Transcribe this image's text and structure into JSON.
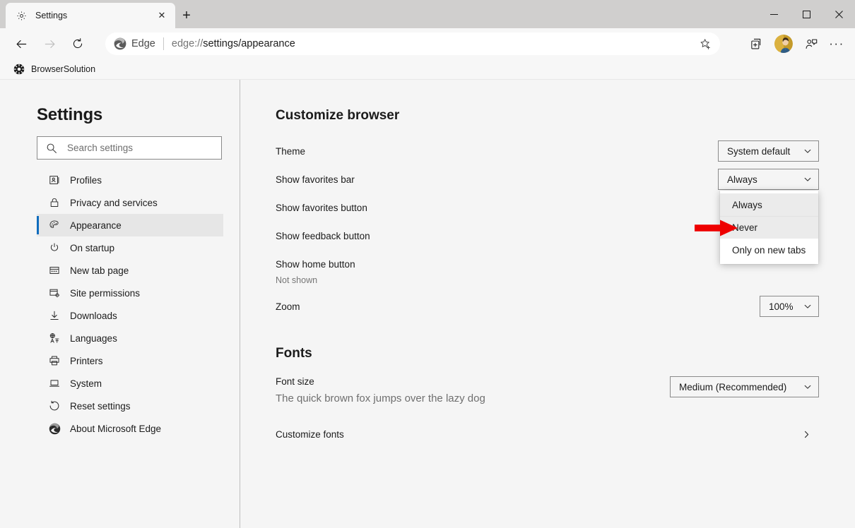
{
  "window": {
    "minimize_label": "—",
    "maximize_label": "□",
    "close_label": "✕"
  },
  "tabstrip": {
    "tabs": [
      {
        "title": "Settings",
        "favicon": "gear-icon",
        "close_label": "✕"
      }
    ],
    "new_tab_label": "+"
  },
  "toolbar": {
    "back_label": "←",
    "forward_label": "→",
    "refresh_label": "↻",
    "brand_label": "Edge",
    "url_prefix": "edge://",
    "url_bold": "settings/appearance",
    "url_full": "edge://settings/appearance",
    "favorite_icon": "star-add-icon",
    "collections_icon": "collections-icon",
    "profile_icon": "avatar",
    "share_icon": "user-feedback-icon",
    "more_label": "···"
  },
  "favorites_bar": {
    "items": [
      {
        "label": "BrowserSolution",
        "icon": "browsersolution-favicon"
      }
    ]
  },
  "sidebar": {
    "title": "Settings",
    "search": {
      "placeholder": "Search settings",
      "value": "",
      "icon": "search-icon"
    },
    "items": [
      {
        "label": "Profiles",
        "icon": "profile-card-icon",
        "active": false
      },
      {
        "label": "Privacy and services",
        "icon": "lock-icon",
        "active": false
      },
      {
        "label": "Appearance",
        "icon": "palette-icon",
        "active": true
      },
      {
        "label": "On startup",
        "icon": "power-icon",
        "active": false
      },
      {
        "label": "New tab page",
        "icon": "new-tab-page-icon",
        "active": false
      },
      {
        "label": "Site permissions",
        "icon": "site-permissions-icon",
        "active": false
      },
      {
        "label": "Downloads",
        "icon": "download-arrow-icon",
        "active": false
      },
      {
        "label": "Languages",
        "icon": "languages-icon",
        "active": false
      },
      {
        "label": "Printers",
        "icon": "printer-icon",
        "active": false
      },
      {
        "label": "System",
        "icon": "laptop-icon",
        "active": false
      },
      {
        "label": "Reset settings",
        "icon": "reset-circular-arrow-icon",
        "active": false
      },
      {
        "label": "About Microsoft Edge",
        "icon": "edge-logo-icon",
        "active": false
      }
    ]
  },
  "content": {
    "customize_browser": {
      "heading": "Customize browser",
      "theme": {
        "label": "Theme",
        "value": "System default"
      },
      "favorites_bar": {
        "label": "Show favorites bar",
        "value": "Always"
      },
      "favorites_button": {
        "label": "Show favorites button"
      },
      "feedback_button": {
        "label": "Show feedback button"
      },
      "home_button": {
        "label": "Show home button",
        "sub": "Not shown",
        "toggle_state": "off"
      },
      "zoom": {
        "label": "Zoom",
        "value": "100%"
      }
    },
    "fonts": {
      "heading": "Fonts",
      "font_size": {
        "label": "Font size",
        "value": "Medium (Recommended)",
        "sample": "The quick brown fox jumps over the lazy dog"
      },
      "customize_fonts": {
        "label": "Customize fonts",
        "chevron": "chevron-right-icon"
      }
    }
  },
  "dropdown_popup": {
    "open_for": "Show favorites bar",
    "options": [
      {
        "label": "Always",
        "highlighted": true
      },
      {
        "label": "Never",
        "highlighted": true
      },
      {
        "label": "Only on new tabs",
        "highlighted": false
      }
    ]
  },
  "annotation": {
    "type": "arrow",
    "color": "#ee0000",
    "points_to": "Never"
  },
  "colors": {
    "accent": "#0f6cbd",
    "titlebar": "#d0cfce",
    "toolbar": "#f7f7f7",
    "page_bg": "#f5f5f5",
    "sidebar_active": "#e6e6e6",
    "popup_highlight": "#ebebeb",
    "annotation_red": "#ee0000"
  }
}
